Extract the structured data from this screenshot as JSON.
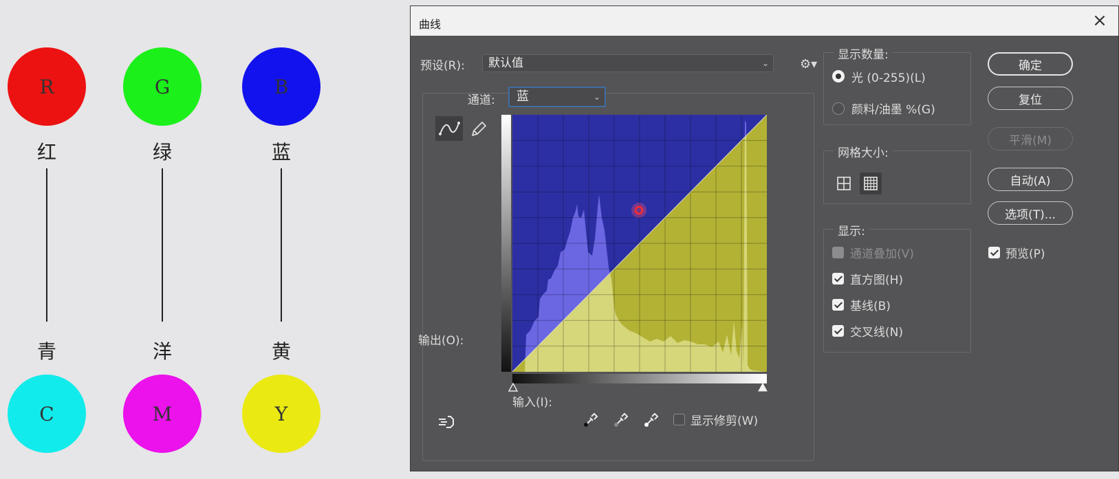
{
  "diagram": {
    "top": [
      {
        "letter": "R",
        "name": "红",
        "color": "#ed1212"
      },
      {
        "letter": "G",
        "name": "绿",
        "color": "#1bf01b"
      },
      {
        "letter": "B",
        "name": "蓝",
        "color": "#1212ee"
      }
    ],
    "bottom": [
      {
        "letter": "C",
        "name": "青",
        "color": "#12ebeb"
      },
      {
        "letter": "M",
        "name": "洋",
        "color": "#eb12eb"
      },
      {
        "letter": "Y",
        "name": "黄",
        "color": "#eaea12"
      }
    ]
  },
  "dialog": {
    "title": "曲线",
    "close_glyph": "×",
    "preset_label": "预设(R):",
    "preset_value": "默认值",
    "channel_label": "通道:",
    "channel_value": "蓝",
    "output_label": "输出(O):",
    "input_label": "输入(I):",
    "show_clipping_label": "显示修剪(W)",
    "show_clipping_checked": false,
    "display_amount": {
      "title": "显示数量:",
      "options": [
        {
          "label": "光 (0-255)(L)",
          "selected": true
        },
        {
          "label": "颜料/油墨 %(G)",
          "selected": false
        }
      ]
    },
    "grid_size": {
      "title": "网格大小:"
    },
    "show": {
      "title": "显示:",
      "options": [
        {
          "label": "通道叠加(V)",
          "checked": true,
          "enabled": false
        },
        {
          "label": "直方图(H)",
          "checked": true,
          "enabled": true
        },
        {
          "label": "基线(B)",
          "checked": true,
          "enabled": true
        },
        {
          "label": "交叉线(N)",
          "checked": true,
          "enabled": true
        }
      ]
    },
    "buttons": {
      "ok": "确定",
      "reset": "复位",
      "smooth": "平滑(M)",
      "auto": "自动(A)",
      "options": "选项(T)..."
    },
    "preview_label": "预览(P)",
    "preview_checked": true
  },
  "colors": {
    "graph_top": "#2c2fa3",
    "graph_bottom": "#b3b235",
    "histogram_over_blue": "#6b66e2",
    "histogram_over_yellow": "#d6d67a",
    "accent_focus": "#3f6ea5"
  }
}
